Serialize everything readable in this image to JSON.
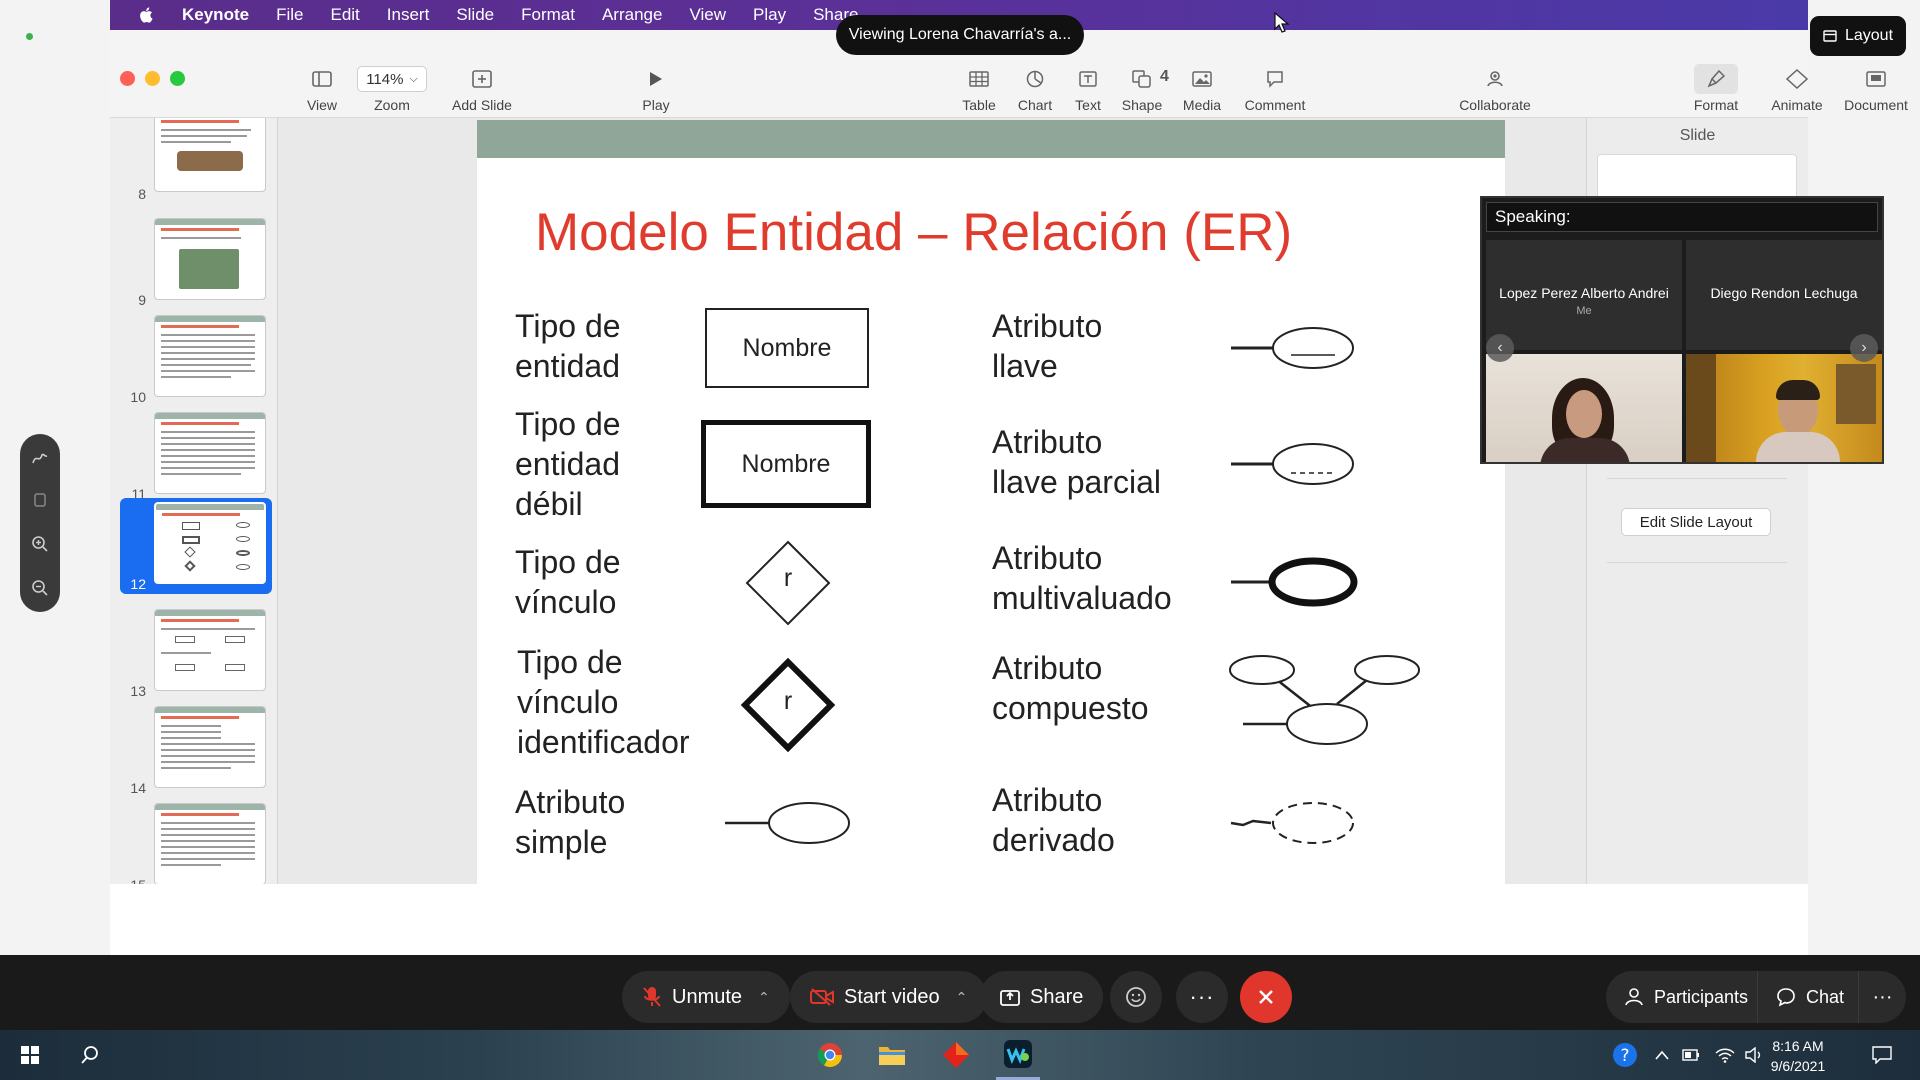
{
  "menubar": {
    "items": [
      {
        "label": "Keynote",
        "bold": true
      },
      {
        "label": "File"
      },
      {
        "label": "Edit"
      },
      {
        "label": "Insert"
      },
      {
        "label": "Slide"
      },
      {
        "label": "Format"
      },
      {
        "label": "Arrange"
      },
      {
        "label": "View"
      },
      {
        "label": "Play"
      },
      {
        "label": "Share"
      }
    ]
  },
  "viewing_banner": "Viewing Lorena Chavarría's a...",
  "layout_button": "Layout",
  "document_title_fragment": "4",
  "toolbar": {
    "view": "View",
    "zoom": "Zoom",
    "zoom_value": "114%",
    "add_slide": "Add Slide",
    "play": "Play",
    "table": "Table",
    "chart": "Chart",
    "text": "Text",
    "shape": "Shape",
    "media": "Media",
    "comment": "Comment",
    "collaborate": "Collaborate",
    "format": "Format",
    "animate": "Animate",
    "document": "Document"
  },
  "navigator": {
    "slides": [
      {
        "num": "8",
        "selected": false
      },
      {
        "num": "9",
        "selected": false
      },
      {
        "num": "10",
        "selected": false
      },
      {
        "num": "11",
        "selected": false
      },
      {
        "num": "12",
        "selected": true
      },
      {
        "num": "13",
        "selected": false
      },
      {
        "num": "14",
        "selected": false
      },
      {
        "num": "15",
        "selected": false
      }
    ]
  },
  "slide": {
    "title": "Modelo Entidad – Relación (ER)",
    "left": [
      {
        "label": "Tipo de\nentidad",
        "symbol_text": "Nombre"
      },
      {
        "label": "Tipo de\nentidad\ndébil",
        "symbol_text": "Nombre"
      },
      {
        "label": "Tipo de\nvínculo",
        "symbol_text": "r"
      },
      {
        "label": "Tipo de\nvínculo\nidentificador",
        "symbol_text": "r"
      },
      {
        "label": "Atributo\nsimple"
      }
    ],
    "right": [
      {
        "label": "Atributo\nllave"
      },
      {
        "label": "Atributo\nllave parcial"
      },
      {
        "label": "Atributo\nmultivaluado"
      },
      {
        "label": "Atributo\ncompuesto"
      },
      {
        "label": "Atributo\nderivado"
      }
    ]
  },
  "inspector": {
    "title": "Slide",
    "edit_layout": "Edit Slide Layout"
  },
  "speaking": {
    "header": "Speaking:",
    "participants": [
      {
        "name": "Lopez Perez Alberto Andrei",
        "tag": "Me"
      },
      {
        "name": "Diego Rendon Lechuga",
        "tag": ""
      }
    ]
  },
  "controls": {
    "unmute": "Unmute",
    "start_video": "Start video",
    "share": "Share",
    "participants": "Participants",
    "chat": "Chat"
  },
  "clock": {
    "time": "8:16 AM",
    "date": "9/6/2021"
  },
  "colors": {
    "accent": "#1a6cf0",
    "slide_title": "#e03c2e",
    "end_call": "#e0362c"
  }
}
